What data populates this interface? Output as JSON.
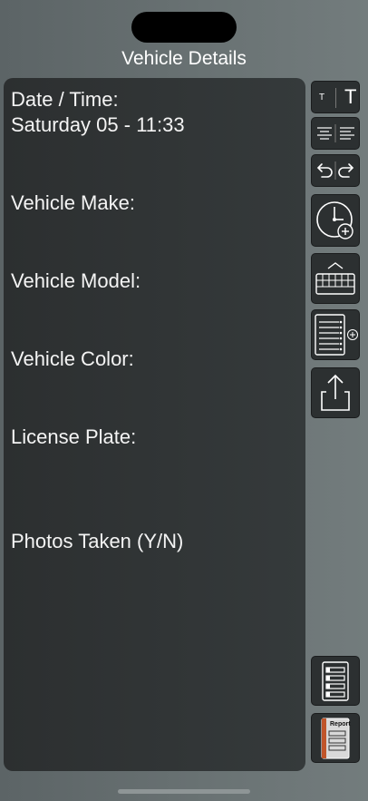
{
  "header": {
    "title": "Vehicle Details"
  },
  "form": {
    "date_label": "Date / Time:",
    "date_value": "Saturday 05 - 11:33",
    "make_label": "Vehicle Make:",
    "model_label": "Vehicle Model:",
    "color_label": "Vehicle Color:",
    "plate_label": "License Plate:",
    "photos_label": "Photos Taken (Y/N)"
  },
  "toolbar": {
    "small_text_glyph": "T",
    "large_text_glyph": "T",
    "report_label": "Report"
  },
  "colors": {
    "background": "#6a7374",
    "editor_bg": "#303435",
    "button_bg": "#2c3031",
    "report_accent": "#c0552a"
  }
}
